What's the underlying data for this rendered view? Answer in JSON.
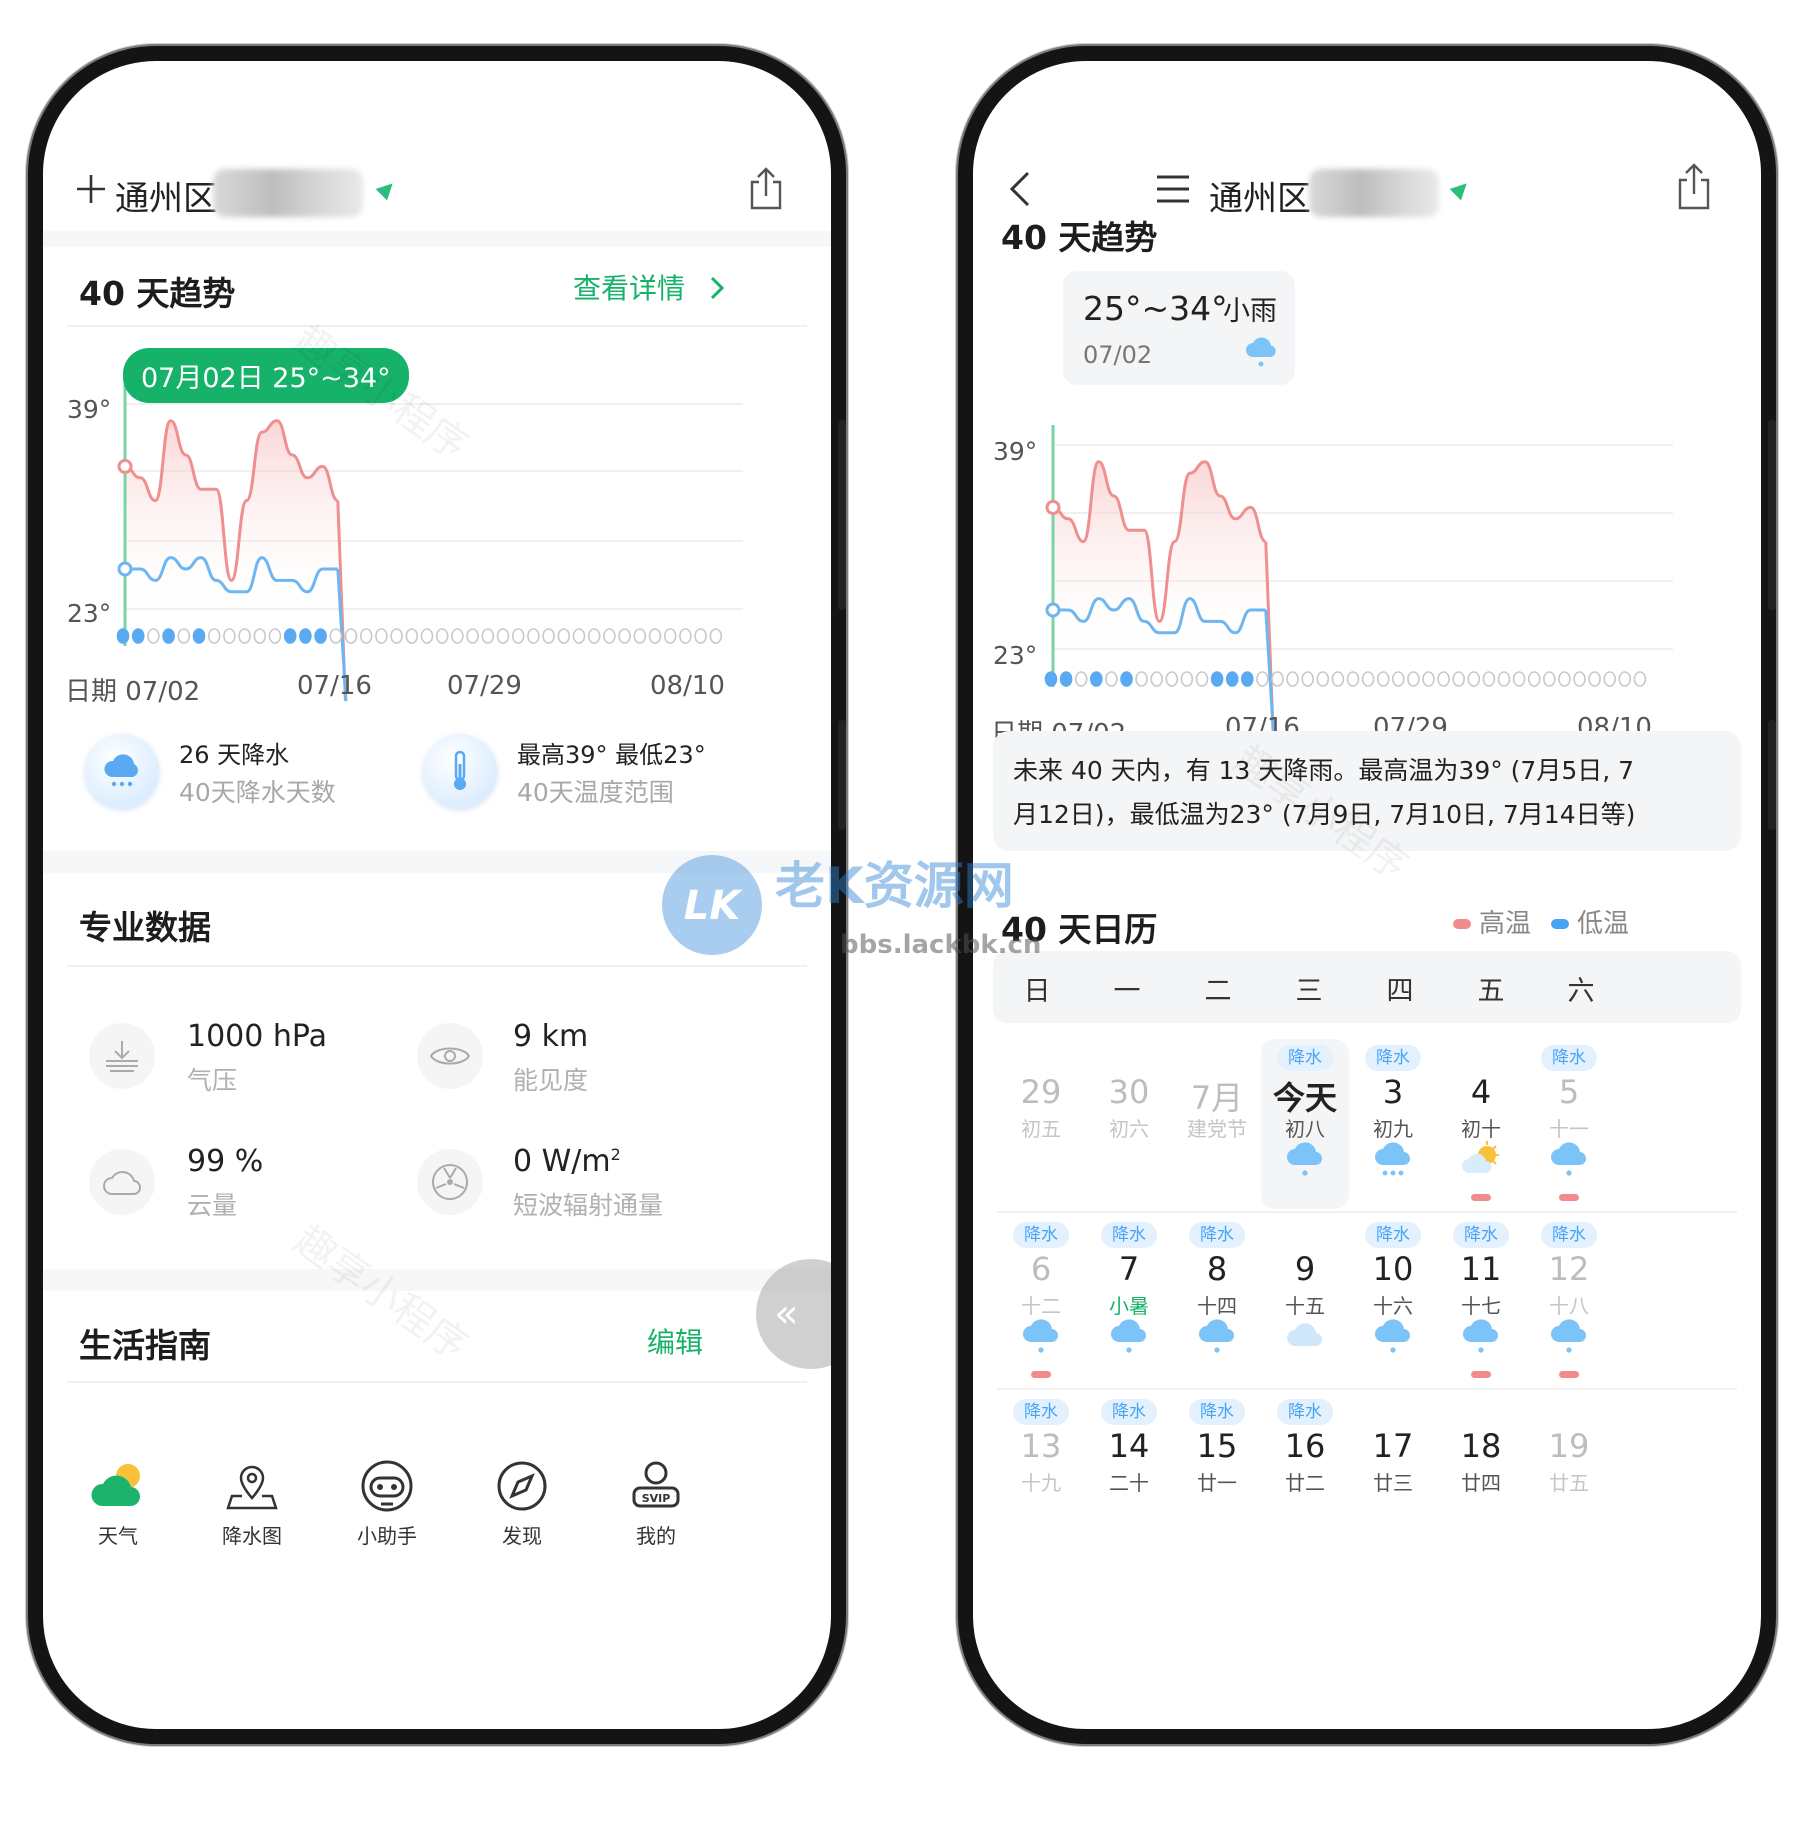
{
  "left": {
    "header": {
      "add_label": "+",
      "location": "通州区"
    },
    "trend": {
      "title": "40 天趋势",
      "detail_link": "查看详情",
      "tooltip": "07月02日 25°~34°",
      "y_high": "39°",
      "y_low": "23°",
      "dates": [
        "日期 07/02",
        "07/16",
        "07/29",
        "08/10"
      ]
    },
    "stats": [
      {
        "main": "26 天降水",
        "sub": "40天降水天数",
        "icon": "rain-cloud-icon"
      },
      {
        "main": "最高39° 最低23°",
        "sub": "40天温度范围",
        "icon": "thermometer-icon"
      }
    ],
    "pro": {
      "title": "专业数据",
      "items": [
        {
          "value": "1000 hPa",
          "label": "气压",
          "icon": "pressure-icon"
        },
        {
          "value": "9 km",
          "label": "能见度",
          "icon": "visibility-eye-icon"
        },
        {
          "value": "99 %",
          "label": "云量",
          "icon": "cloud-icon"
        },
        {
          "value": "0 W/m",
          "sup": "2",
          "label": "短波辐射通量",
          "icon": "radiation-icon"
        }
      ]
    },
    "life": {
      "title": "生活指南",
      "edit": "编辑"
    },
    "fab": "«",
    "nav": [
      {
        "label": "天气",
        "icon": "weather-icon"
      },
      {
        "label": "降水图",
        "icon": "rain-map-icon"
      },
      {
        "label": "小助手",
        "icon": "assistant-robot-icon"
      },
      {
        "label": "发现",
        "icon": "compass-icon"
      },
      {
        "label": "我的",
        "icon": "svip-user-icon",
        "badge": "SVIP"
      }
    ]
  },
  "right": {
    "header": {
      "location": "通州区"
    },
    "trend": {
      "title": "40 天趋势",
      "tip_range": "25°~34°",
      "tip_cond": "小雨",
      "tip_date": "07/02",
      "y_high": "39°",
      "y_low": "23°",
      "dates": [
        "日期 07/02",
        "07/16",
        "07/29",
        "08/10"
      ]
    },
    "summary_line1": "未来 40 天内，有 13 天降雨。最高温为39° (7月5日, 7",
    "summary_line2": "月12日)，最低温为23° (7月9日, 7月10日, 7月14日等)",
    "calendar": {
      "title": "40 天日历",
      "legend_high": "高温",
      "legend_low": "低温",
      "weekdays": [
        "日",
        "一",
        "二",
        "三",
        "四",
        "五",
        "六"
      ],
      "rain_tag": "降水",
      "rows": [
        [
          {
            "day": "29",
            "lunar": "初五",
            "muted": true
          },
          {
            "day": "30",
            "lunar": "初六",
            "muted": true
          },
          {
            "day": "7月",
            "lunar": "建党节",
            "muted": true
          },
          {
            "day": "今天",
            "lunar": "初八",
            "rain": true,
            "wx": "rain",
            "today": true
          },
          {
            "day": "3",
            "lunar": "初九",
            "rain": true,
            "wx": "heavy-rain"
          },
          {
            "day": "4",
            "lunar": "初十",
            "wx": "sun-cloud",
            "hi": true
          },
          {
            "day": "5",
            "lunar": "十一",
            "rain": true,
            "wx": "rain",
            "hi": true,
            "muted": true
          }
        ],
        [
          {
            "day": "6",
            "lunar": "十二",
            "rain": true,
            "wx": "rain",
            "hi": true,
            "muted": true
          },
          {
            "day": "7",
            "lunar": "小暑",
            "rain": true,
            "wx": "rain",
            "green": true
          },
          {
            "day": "8",
            "lunar": "十四",
            "rain": true,
            "wx": "rain"
          },
          {
            "day": "9",
            "lunar": "十五",
            "wx": "cloud"
          },
          {
            "day": "10",
            "lunar": "十六",
            "rain": true,
            "wx": "rain"
          },
          {
            "day": "11",
            "lunar": "十七",
            "rain": true,
            "wx": "rain",
            "hi": true
          },
          {
            "day": "12",
            "lunar": "十八",
            "rain": true,
            "wx": "rain",
            "hi": true,
            "muted": true
          }
        ],
        [
          {
            "day": "13",
            "lunar": "十九",
            "rain": true,
            "muted": true
          },
          {
            "day": "14",
            "lunar": "二十",
            "rain": true
          },
          {
            "day": "15",
            "lunar": "廿一",
            "rain": true
          },
          {
            "day": "16",
            "lunar": "廿二",
            "rain": true
          },
          {
            "day": "17",
            "lunar": "廿三"
          },
          {
            "day": "18",
            "lunar": "廿四"
          },
          {
            "day": "19",
            "lunar": "廿五",
            "muted": true
          }
        ]
      ]
    }
  },
  "watermarks": {
    "brand": "老K资源网",
    "url": "bbs.lackbk.cn",
    "logo": "LK",
    "diag": "趣享小程序"
  },
  "chart_data": [
    {
      "type": "line",
      "title": "40 天趋势",
      "x": [
        "07/02",
        "07/03",
        "07/04",
        "07/05",
        "07/06",
        "07/07",
        "07/08",
        "07/09",
        "07/10",
        "07/11",
        "07/12",
        "07/13",
        "07/14",
        "07/15",
        "07/16"
      ],
      "series": [
        {
          "name": "高温",
          "values": [
            34,
            33,
            31,
            38,
            35,
            32,
            32,
            24,
            31,
            37,
            38,
            35,
            33,
            34,
            31
          ]
        },
        {
          "name": "低温",
          "values": [
            25,
            25,
            24,
            26,
            25,
            26,
            24,
            23,
            23,
            26,
            24,
            24,
            23,
            25,
            25
          ]
        }
      ],
      "rain_days": [
        1,
        1,
        0,
        1,
        0,
        1,
        0,
        0,
        0,
        0,
        0,
        1,
        1,
        1,
        0
      ],
      "ylim": [
        20,
        40
      ],
      "xlabel": "日期"
    }
  ]
}
